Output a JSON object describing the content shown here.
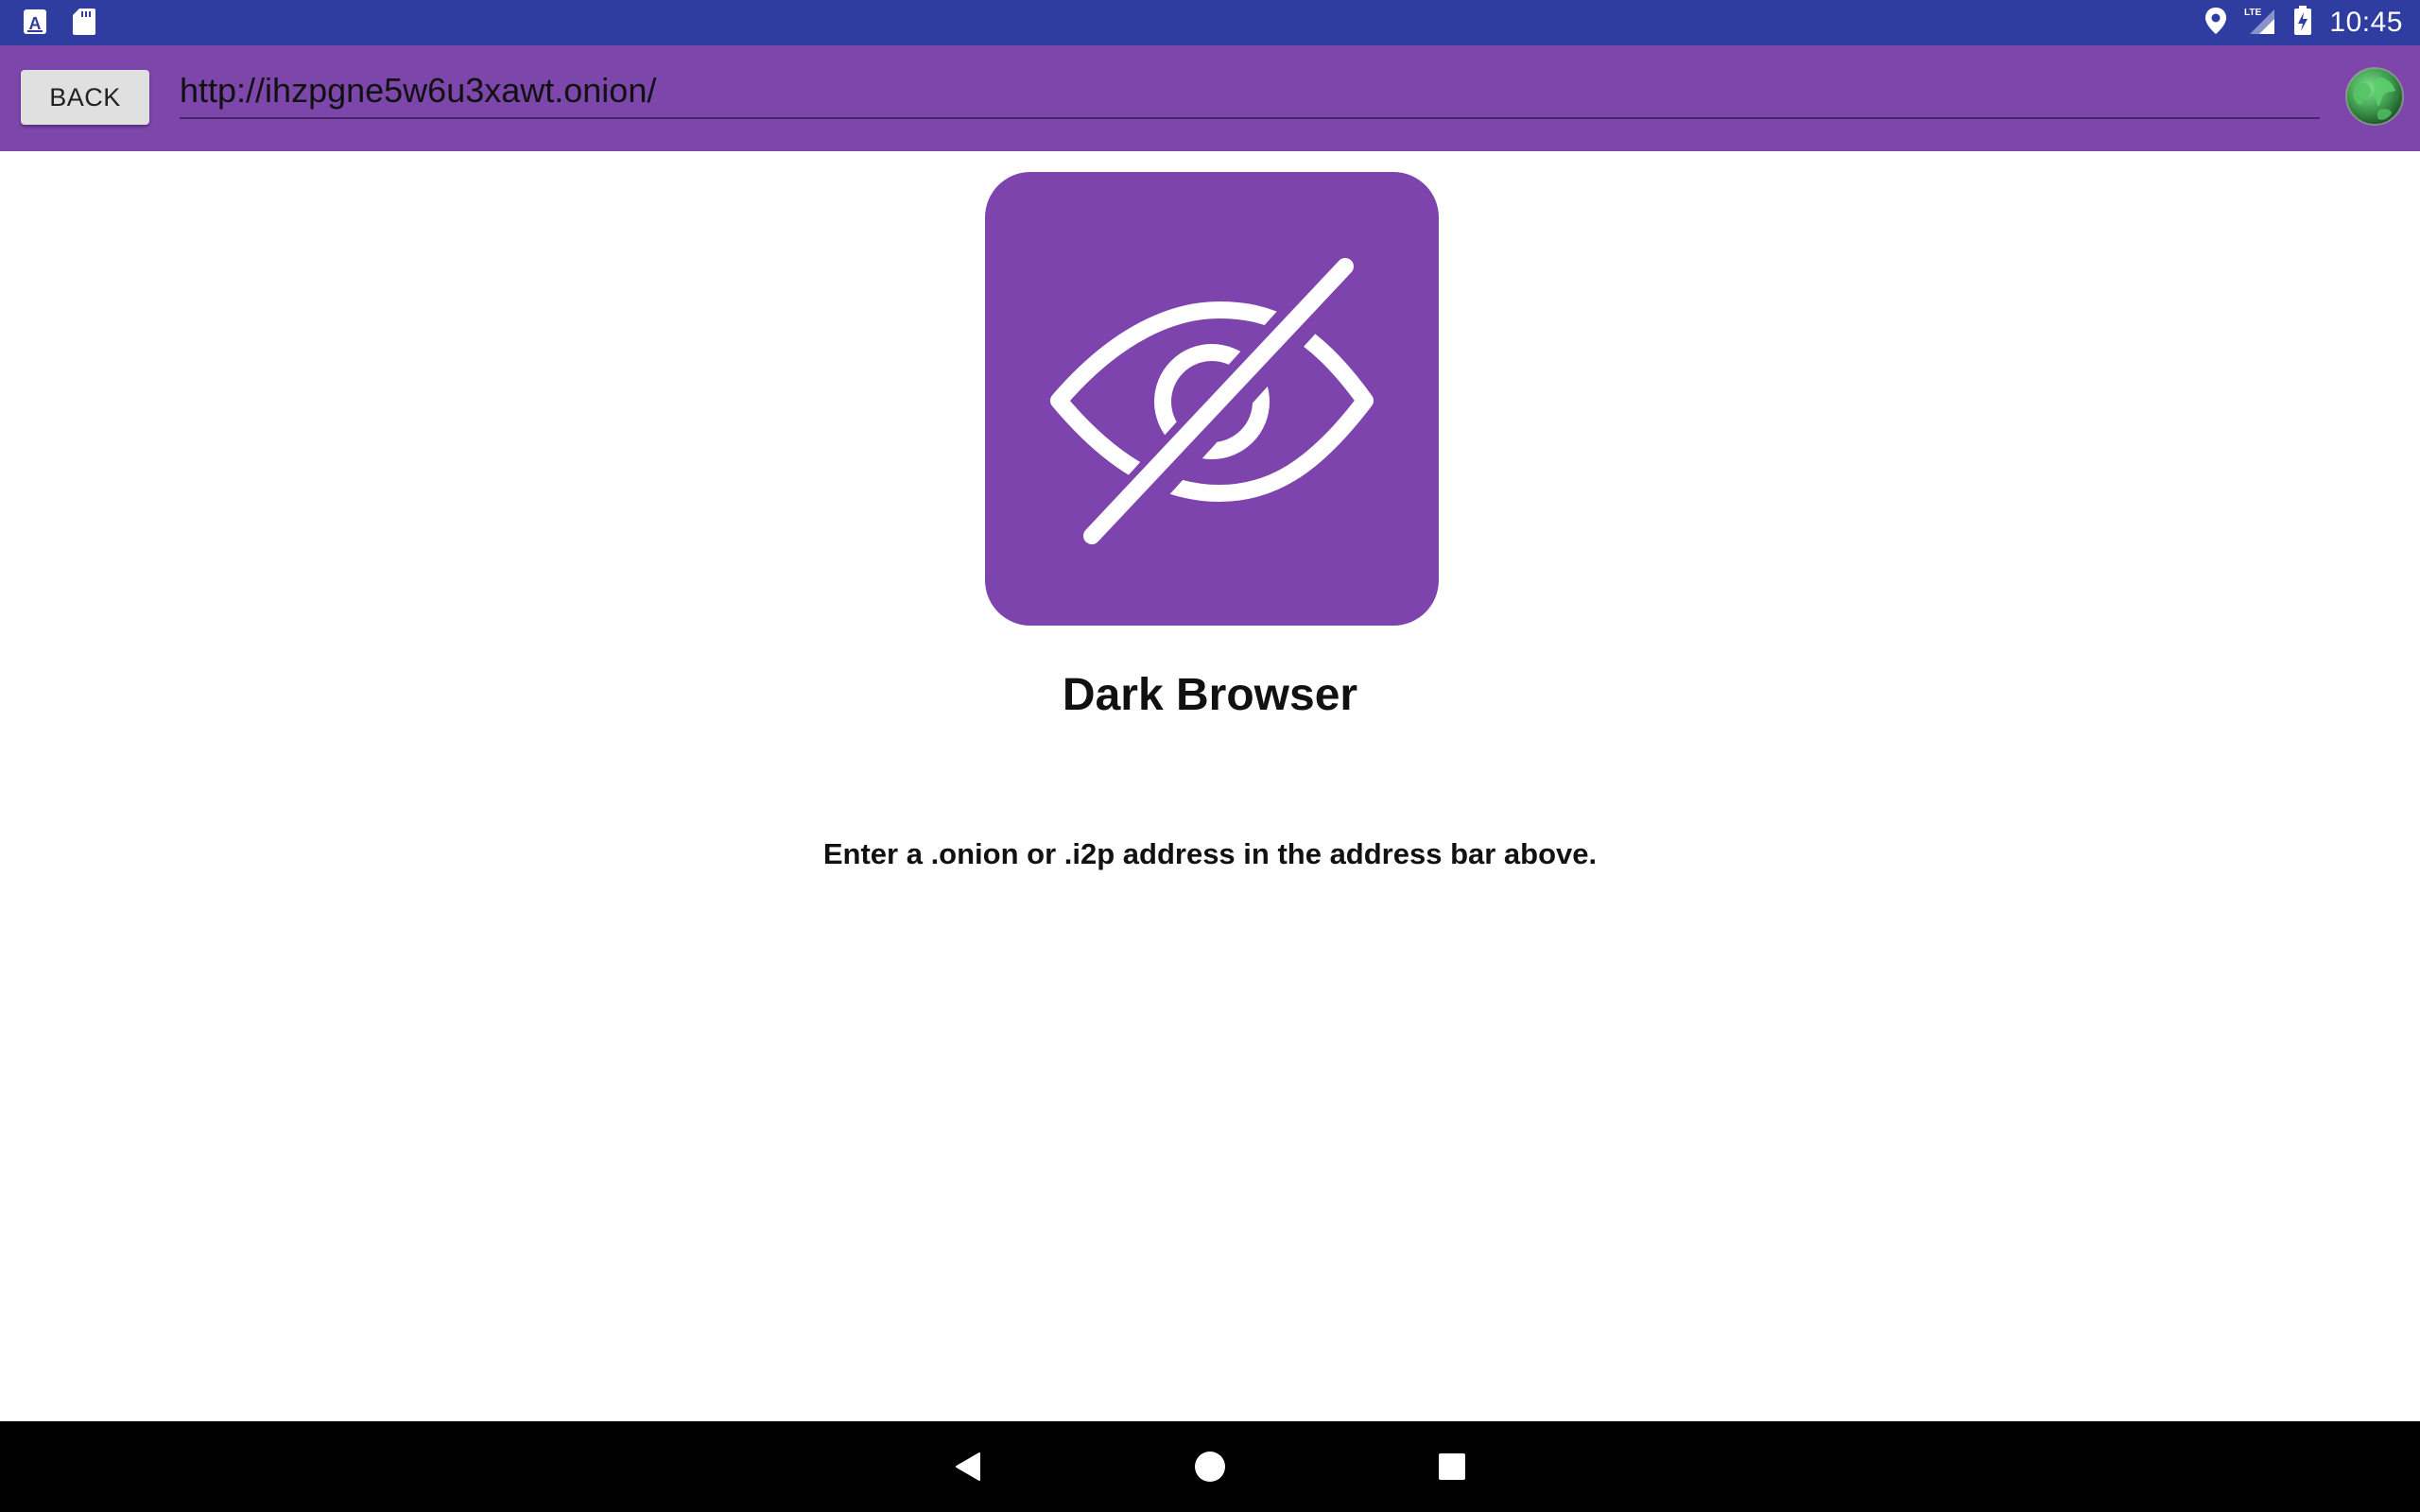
{
  "status_bar": {
    "left_icons": [
      "keyboard-a-icon",
      "sd-card-icon"
    ],
    "right_icons": [
      "location-icon",
      "lte-signal-icon",
      "battery-charging-icon"
    ],
    "network_label": "LTE",
    "time": "10:45",
    "color": "#2e3d9f"
  },
  "toolbar": {
    "back_label": "BACK",
    "url": "http://ihzpgne5w6u3xawt.onion/",
    "globe_icon": "globe-icon",
    "color": "#7c46ab"
  },
  "main": {
    "logo_icon": "eye-off-icon",
    "logo_color": "#7c44ac",
    "title": "Dark Browser",
    "hint": "Enter a .onion or .i2p address in the address bar above."
  },
  "nav_bar": {
    "buttons": [
      "back-triangle-icon",
      "home-circle-icon",
      "recents-square-icon"
    ]
  }
}
